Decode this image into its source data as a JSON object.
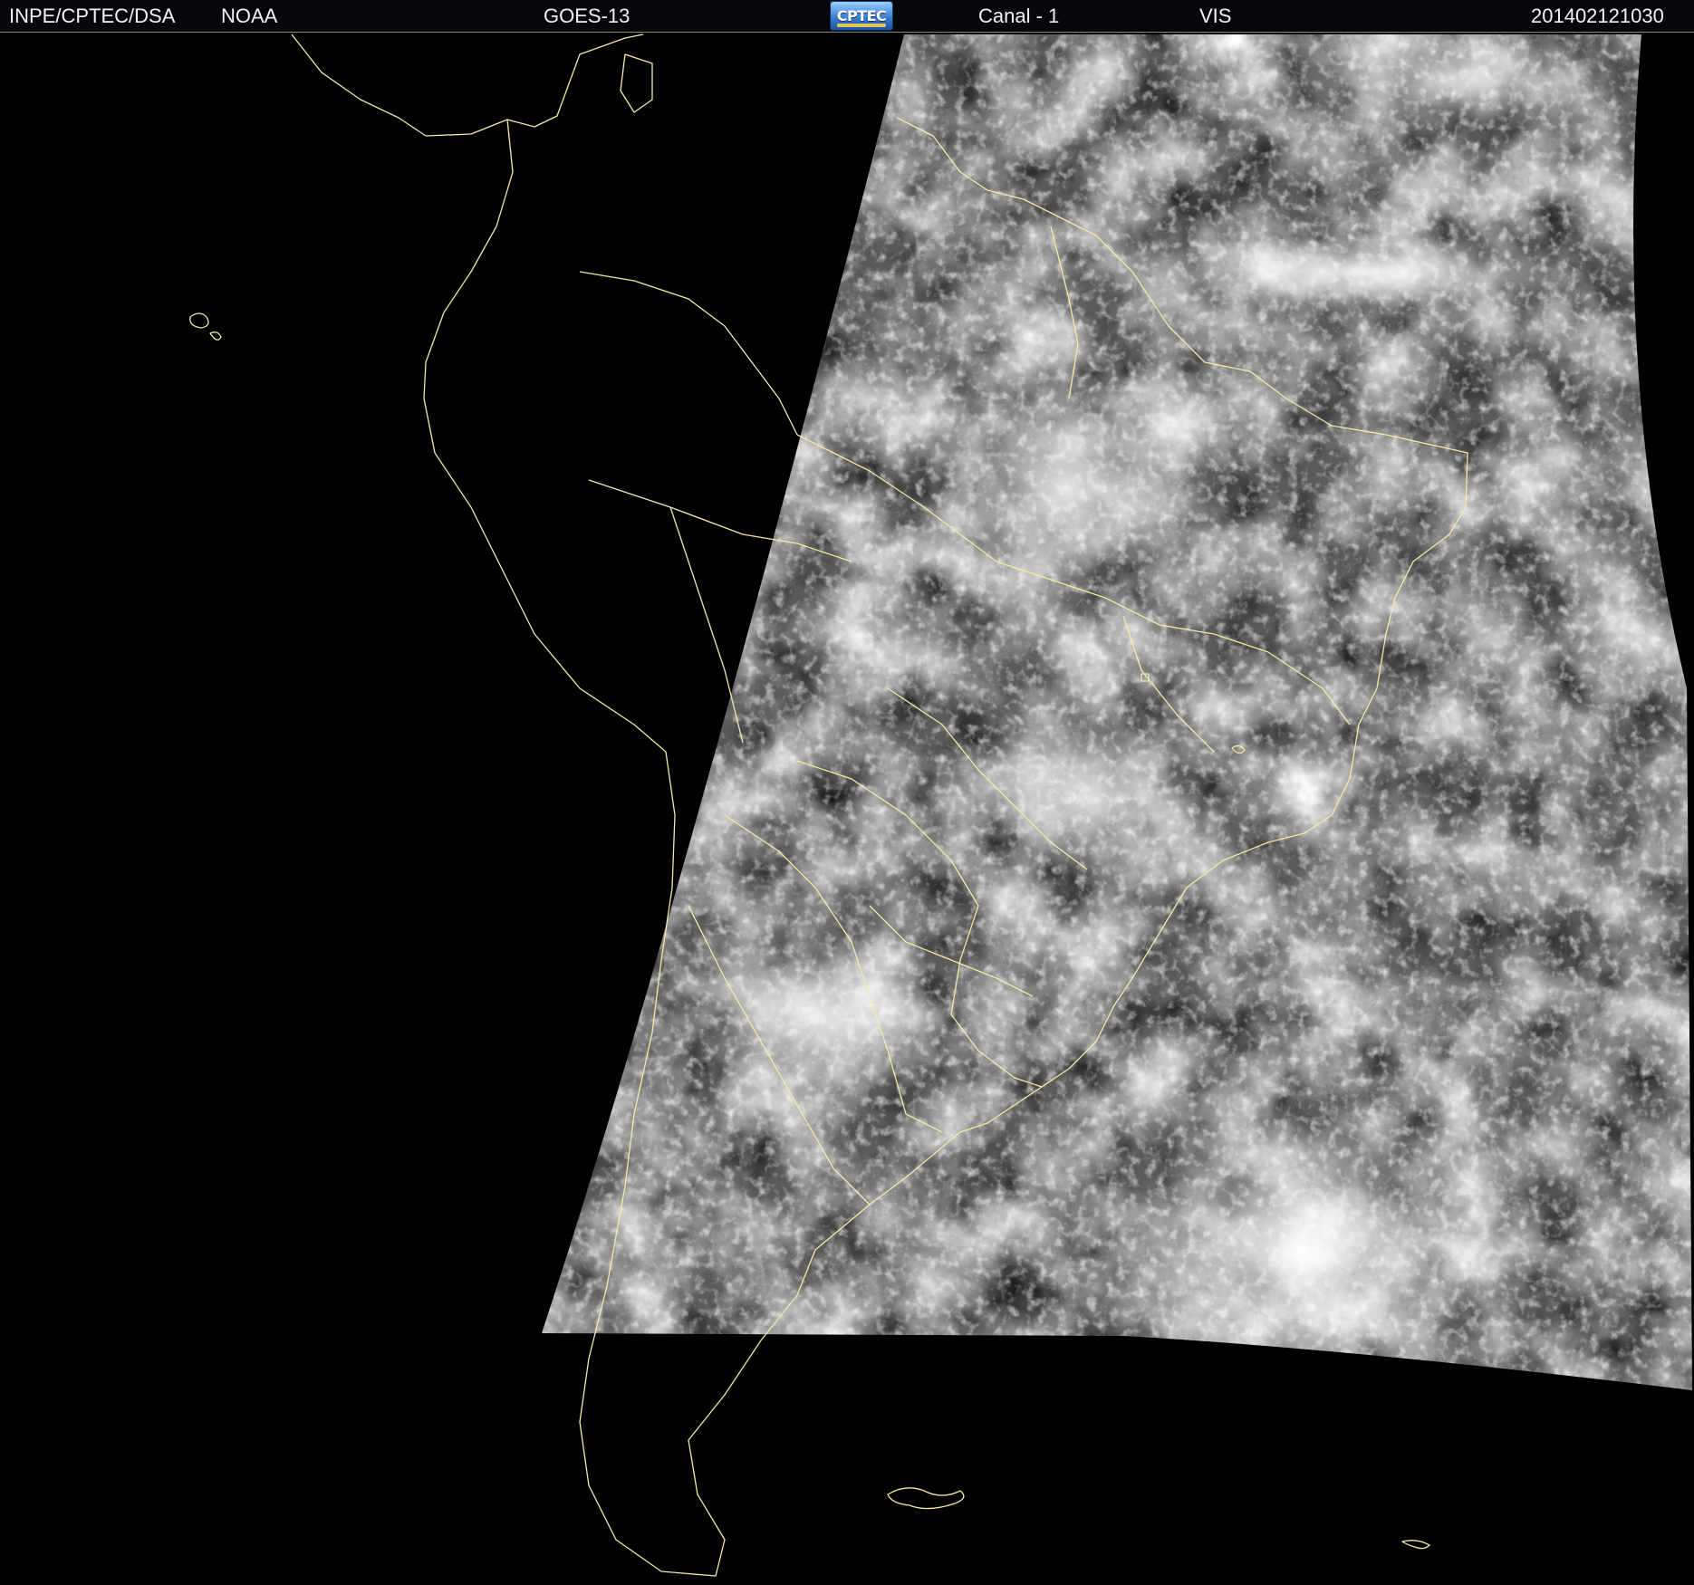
{
  "header": {
    "source": "INPE/CPTEC/DSA",
    "agency": "NOAA",
    "satellite": "GOES-13",
    "logo_text": "CPTEC",
    "channel": "Canal - 1",
    "band": "VIS",
    "timestamp": "201402121030"
  },
  "colors": {
    "background": "#000000",
    "header_background": "#05070a",
    "header_text": "#f2f2f2",
    "coastline": "#f2eca4",
    "cloud_bright": "#f4f4f4",
    "surface_gray": "#5a5a5a"
  }
}
